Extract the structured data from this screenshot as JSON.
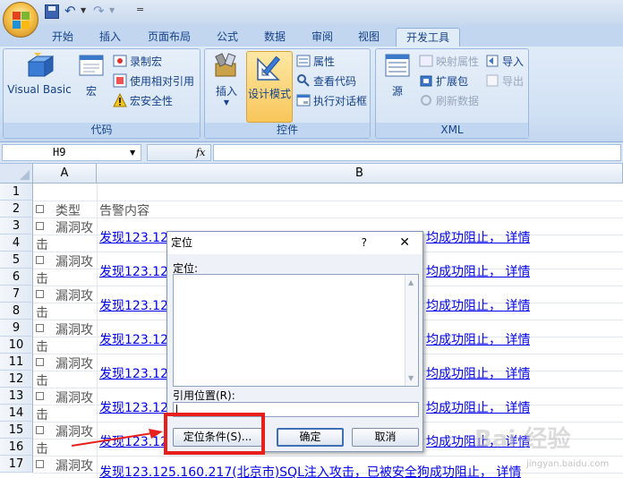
{
  "quick_access": {
    "office_button": "office-button",
    "save": "save-icon",
    "undo": "↶",
    "redo": "↷",
    "customize": "="
  },
  "tabs": [
    "开始",
    "插入",
    "页面布局",
    "公式",
    "数据",
    "审阅",
    "视图",
    "开发工具"
  ],
  "active_tab": "开发工具",
  "ribbon": {
    "code_group": {
      "label": "代码",
      "visual_basic": "Visual Basic",
      "macros": "宏",
      "record_macro": "录制宏",
      "relative_ref": "使用相对引用",
      "macro_security": "宏安全性"
    },
    "controls_group": {
      "label": "控件",
      "insert": "插入",
      "design_mode": "设计模式",
      "properties": "属性",
      "view_code": "查看代码",
      "run_dialog": "执行对话框"
    },
    "xml_group": {
      "label": "XML",
      "source": "源",
      "map_properties": "映射属性",
      "expansion_packs": "扩展包",
      "refresh_data": "刷新数据",
      "import": "导入",
      "export": "导出"
    }
  },
  "formula_bar": {
    "name_box": "H9",
    "fx": "fx",
    "formula": ""
  },
  "sheet": {
    "columns": [
      "A",
      "B"
    ],
    "rows": [
      "1",
      "2",
      "3",
      "4",
      "5",
      "6",
      "7",
      "8",
      "9",
      "10",
      "11",
      "12",
      "13",
      "14",
      "15",
      "16",
      "17"
    ],
    "header_a": "类型",
    "header_b": "告警内容",
    "type_top": "漏洞攻",
    "type_bottom": "击",
    "link_left": "发现123.12",
    "link_right": "均成功阻止， 详情",
    "last_row_text": "发现123.125.160.217(北京市)SQL注入攻击，已被安全狗成功阻止， 详情"
  },
  "dialog": {
    "title": "定位",
    "help": "?",
    "close": "✕",
    "goto_label": "定位:",
    "reference_label": "引用位置(R):",
    "reference_value": "",
    "special_button": "定位条件(S)...",
    "ok_button": "确定",
    "cancel_button": "取消"
  },
  "annotation_colors": {
    "highlight": "#e8201c"
  },
  "watermark": {
    "text": "Bai 经验",
    "sub": "jingyan.baidu.com"
  }
}
